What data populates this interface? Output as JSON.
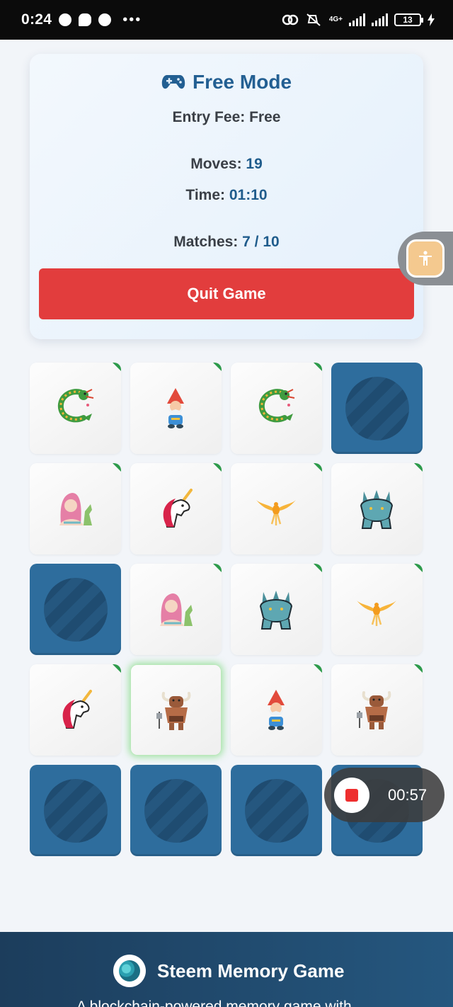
{
  "status_bar": {
    "time": "0:24",
    "dots": "•••",
    "network": "4G+",
    "battery": "13"
  },
  "game_info": {
    "mode_title": "Free Mode",
    "entry_fee_label": "Entry Fee:",
    "entry_fee_value": "Free",
    "moves_label": "Moves:",
    "moves_value": "19",
    "time_label": "Time:",
    "time_value": "01:10",
    "matches_label": "Matches:",
    "matches_value": "7 / 10",
    "quit_label": "Quit Game"
  },
  "board": {
    "rows": [
      [
        "dragon",
        "gnome",
        "dragon",
        "hidden"
      ],
      [
        "mermaid",
        "unicorn",
        "phoenix",
        "werewolf"
      ],
      [
        "hidden",
        "mermaid",
        "werewolf",
        "phoenix"
      ],
      [
        "unicorn",
        "minotaur",
        "gnome",
        "minotaur"
      ],
      [
        "hidden",
        "hidden",
        "hidden",
        "hidden"
      ]
    ],
    "selected_card": "minotaur"
  },
  "recording": {
    "time": "00:57"
  },
  "footer": {
    "title": "Steem Memory Game",
    "tagline": "A blockchain-powered memory game with"
  }
}
